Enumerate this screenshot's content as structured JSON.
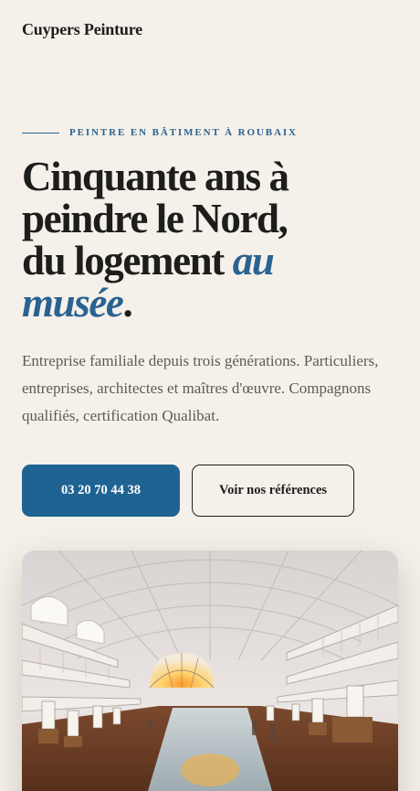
{
  "header": {
    "brand": "Cuypers Peinture"
  },
  "hero": {
    "eyebrow": "PEINTRE EN BÂTIMENT À ROUBAIX",
    "headline_line1": "Cinquante ans à",
    "headline_line2": "peindre le Nord,",
    "headline_line3_prefix": "du logement ",
    "headline_accent_1": "au",
    "headline_accent_2": "musée",
    "headline_period": ".",
    "intro": "Entreprise familiale depuis trois générations. Particuliers, entreprises, architectes et maîtres d'œuvre. Compagnons qualifiés, certification Qualibat."
  },
  "actions": {
    "phone_label": "03 20 70 44 38",
    "references_label": "Voir nos références"
  },
  "colors": {
    "background": "#f5f1ea",
    "accent": "#2a6291",
    "button": "#1f6393",
    "text": "#1d1d1b"
  }
}
